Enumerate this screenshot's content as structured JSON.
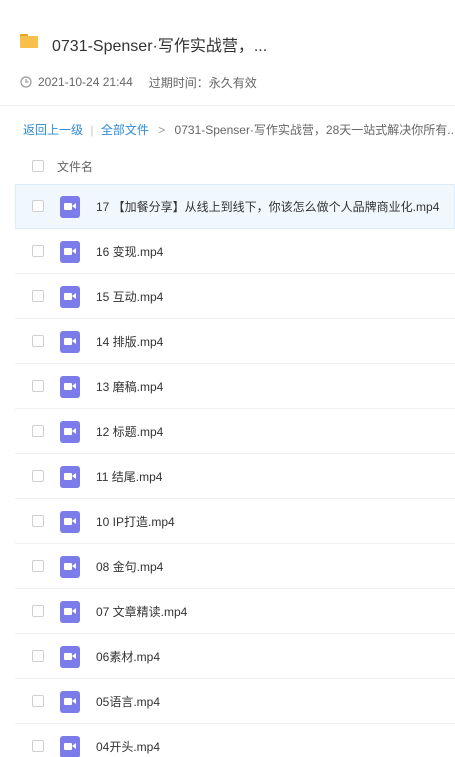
{
  "share": {
    "title": "0731-Spenser·写作实战营，...",
    "date": "2021-10-24 21:44",
    "expiry": "过期时间：永久有效"
  },
  "breadcrumb": {
    "back": "返回上一级",
    "separator": "|",
    "all_files": "全部文件",
    "arrow": ">",
    "current": "0731-Spenser·写作实战营，28天一站式解决你所有..."
  },
  "list": {
    "column_name": "文件名",
    "files": [
      {
        "name": "17 【加餐分享】从线上到线下，你该怎么做个人品牌商业化.mp4",
        "selected": true
      },
      {
        "name": "16 变现.mp4"
      },
      {
        "name": "15 互动.mp4"
      },
      {
        "name": "14 排版.mp4"
      },
      {
        "name": "13 磨稿.mp4"
      },
      {
        "name": "12 标题.mp4"
      },
      {
        "name": "11 结尾.mp4"
      },
      {
        "name": "10 IP打造.mp4"
      },
      {
        "name": "08 金句.mp4"
      },
      {
        "name": "07 文章精读.mp4"
      },
      {
        "name": "06素材.mp4"
      },
      {
        "name": "05语言.mp4"
      },
      {
        "name": "04开头.mp4"
      }
    ]
  },
  "icons": {
    "folder": "folder-icon",
    "clock": "clock-icon",
    "file": "video-file-icon"
  },
  "colors": {
    "link": "#2f8bd6",
    "video_icon": "#7b7bea",
    "folder": "#f7c04a",
    "selected_row": "#f0f8fe"
  }
}
